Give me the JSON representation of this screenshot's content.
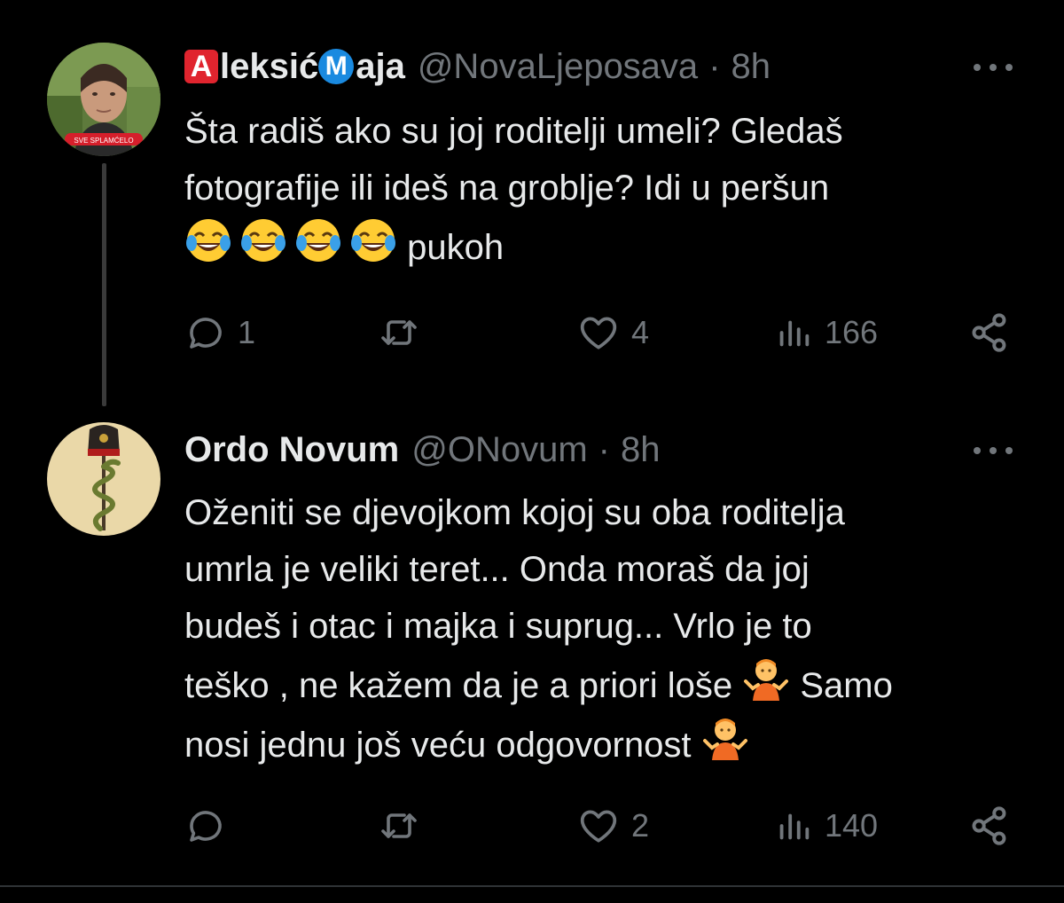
{
  "tweets": [
    {
      "avatar_caption": "SVE SPLAMĆELO",
      "name_badge_1": "A",
      "name_part_1": "leksić",
      "name_badge_2": "M",
      "name_part_2": "aja",
      "handle": "@NovaLjeposava",
      "separator": "·",
      "time": "8h",
      "text_lines": [
        "Šta radiš ako su joj roditelji umeli? Gledaš",
        "fotografije ili ideš na groblje? Idi u peršun"
      ],
      "text_tail": " pukoh",
      "emoji_icon": "face-with-tears-of-joy-icon",
      "actions": {
        "reply_count": "1",
        "retweet_count": "",
        "like_count": "4",
        "views_count": "166"
      }
    },
    {
      "name": "Ordo Novum",
      "handle": "@ONovum",
      "separator": "·",
      "time": "8h",
      "text_lines": [
        "Oženiti se djevojkom kojoj su oba roditelja",
        "umrla je veliki teret... Onda moraš da joj",
        "budeš i otac i majka i suprug... Vrlo je to"
      ],
      "text_line4_a": "teško , ne kažem da je a priori loše ",
      "text_line4_b": " Samo",
      "text_line5": "nosi jednu još veću odgovornost ",
      "emoji_icon": "person-shrugging-icon",
      "actions": {
        "reply_count": "",
        "retweet_count": "",
        "like_count": "2",
        "views_count": "140"
      }
    }
  ],
  "colors": {
    "background": "#000000",
    "text": "#e7e9ea",
    "muted": "#71767b",
    "badge_red": "#e0242e",
    "badge_blue": "#1a8ae0"
  }
}
